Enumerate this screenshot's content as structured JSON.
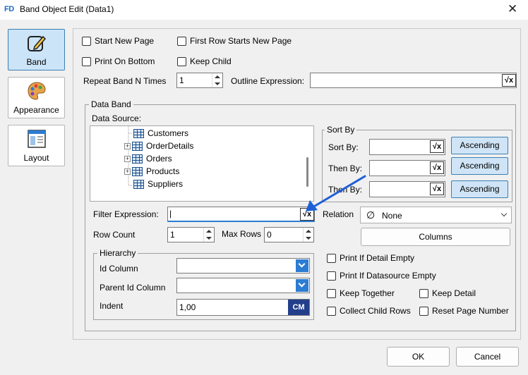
{
  "window": {
    "title": "Band Object Edit (Data1)",
    "logo": "FD",
    "close": "✕"
  },
  "nav": [
    {
      "label": "Band",
      "icon": "pencil-icon"
    },
    {
      "label": "Appearance",
      "icon": "palette-icon"
    },
    {
      "label": "Layout",
      "icon": "layout-icon"
    }
  ],
  "band": {
    "start_new_page": "Start New Page",
    "first_row_starts_new_page": "First Row Starts New Page",
    "print_on_bottom": "Print On Bottom",
    "keep_child": "Keep Child",
    "repeat_label": "Repeat Band N Times",
    "repeat_value": "1",
    "outline_label": "Outline Expression:",
    "outline_value": ""
  },
  "data_band": {
    "title": "Data Band",
    "source_label": "Data Source:",
    "tree": [
      {
        "label": "Customers",
        "expandable": false
      },
      {
        "label": "OrderDetails",
        "expandable": true
      },
      {
        "label": "Orders",
        "expandable": true
      },
      {
        "label": "Products",
        "expandable": true
      },
      {
        "label": "Suppliers",
        "expandable": false
      }
    ],
    "sort": {
      "title": "Sort By",
      "rows": [
        {
          "label": "Sort By:",
          "value": "",
          "order": "Ascending"
        },
        {
          "label": "Then By:",
          "value": "",
          "order": "Ascending"
        },
        {
          "label": "Then By:",
          "value": "",
          "order": "Ascending"
        }
      ]
    },
    "filter_label": "Filter Expression:",
    "filter_value": "|",
    "relation_label": "Relation",
    "relation_value": "None",
    "relation_icon": "∅",
    "columns_label": "Columns",
    "row_count_label": "Row Count",
    "row_count_value": "1",
    "max_rows_label": "Max Rows",
    "max_rows_value": "0",
    "hierarchy": {
      "title": "Hierarchy",
      "id_column_label": "Id Column",
      "id_column_value": "",
      "parent_id_label": "Parent Id Column",
      "parent_id_value": "",
      "indent_label": "Indent",
      "indent_value": "1,00",
      "unit": "CM"
    },
    "options": {
      "print_if_detail_empty": "Print If Detail Empty",
      "print_if_datasource_empty": "Print If Datasource Empty",
      "keep_together": "Keep Together",
      "keep_detail": "Keep Detail",
      "collect_child_rows": "Collect Child Rows",
      "reset_page_number": "Reset Page Number"
    }
  },
  "expr_glyph": "√x",
  "buttons": {
    "ok": "OK",
    "cancel": "Cancel"
  },
  "colors": {
    "accent": "#2b7cd3",
    "arrow": "#1e5fd8",
    "selected_nav": "#cce4f7"
  }
}
